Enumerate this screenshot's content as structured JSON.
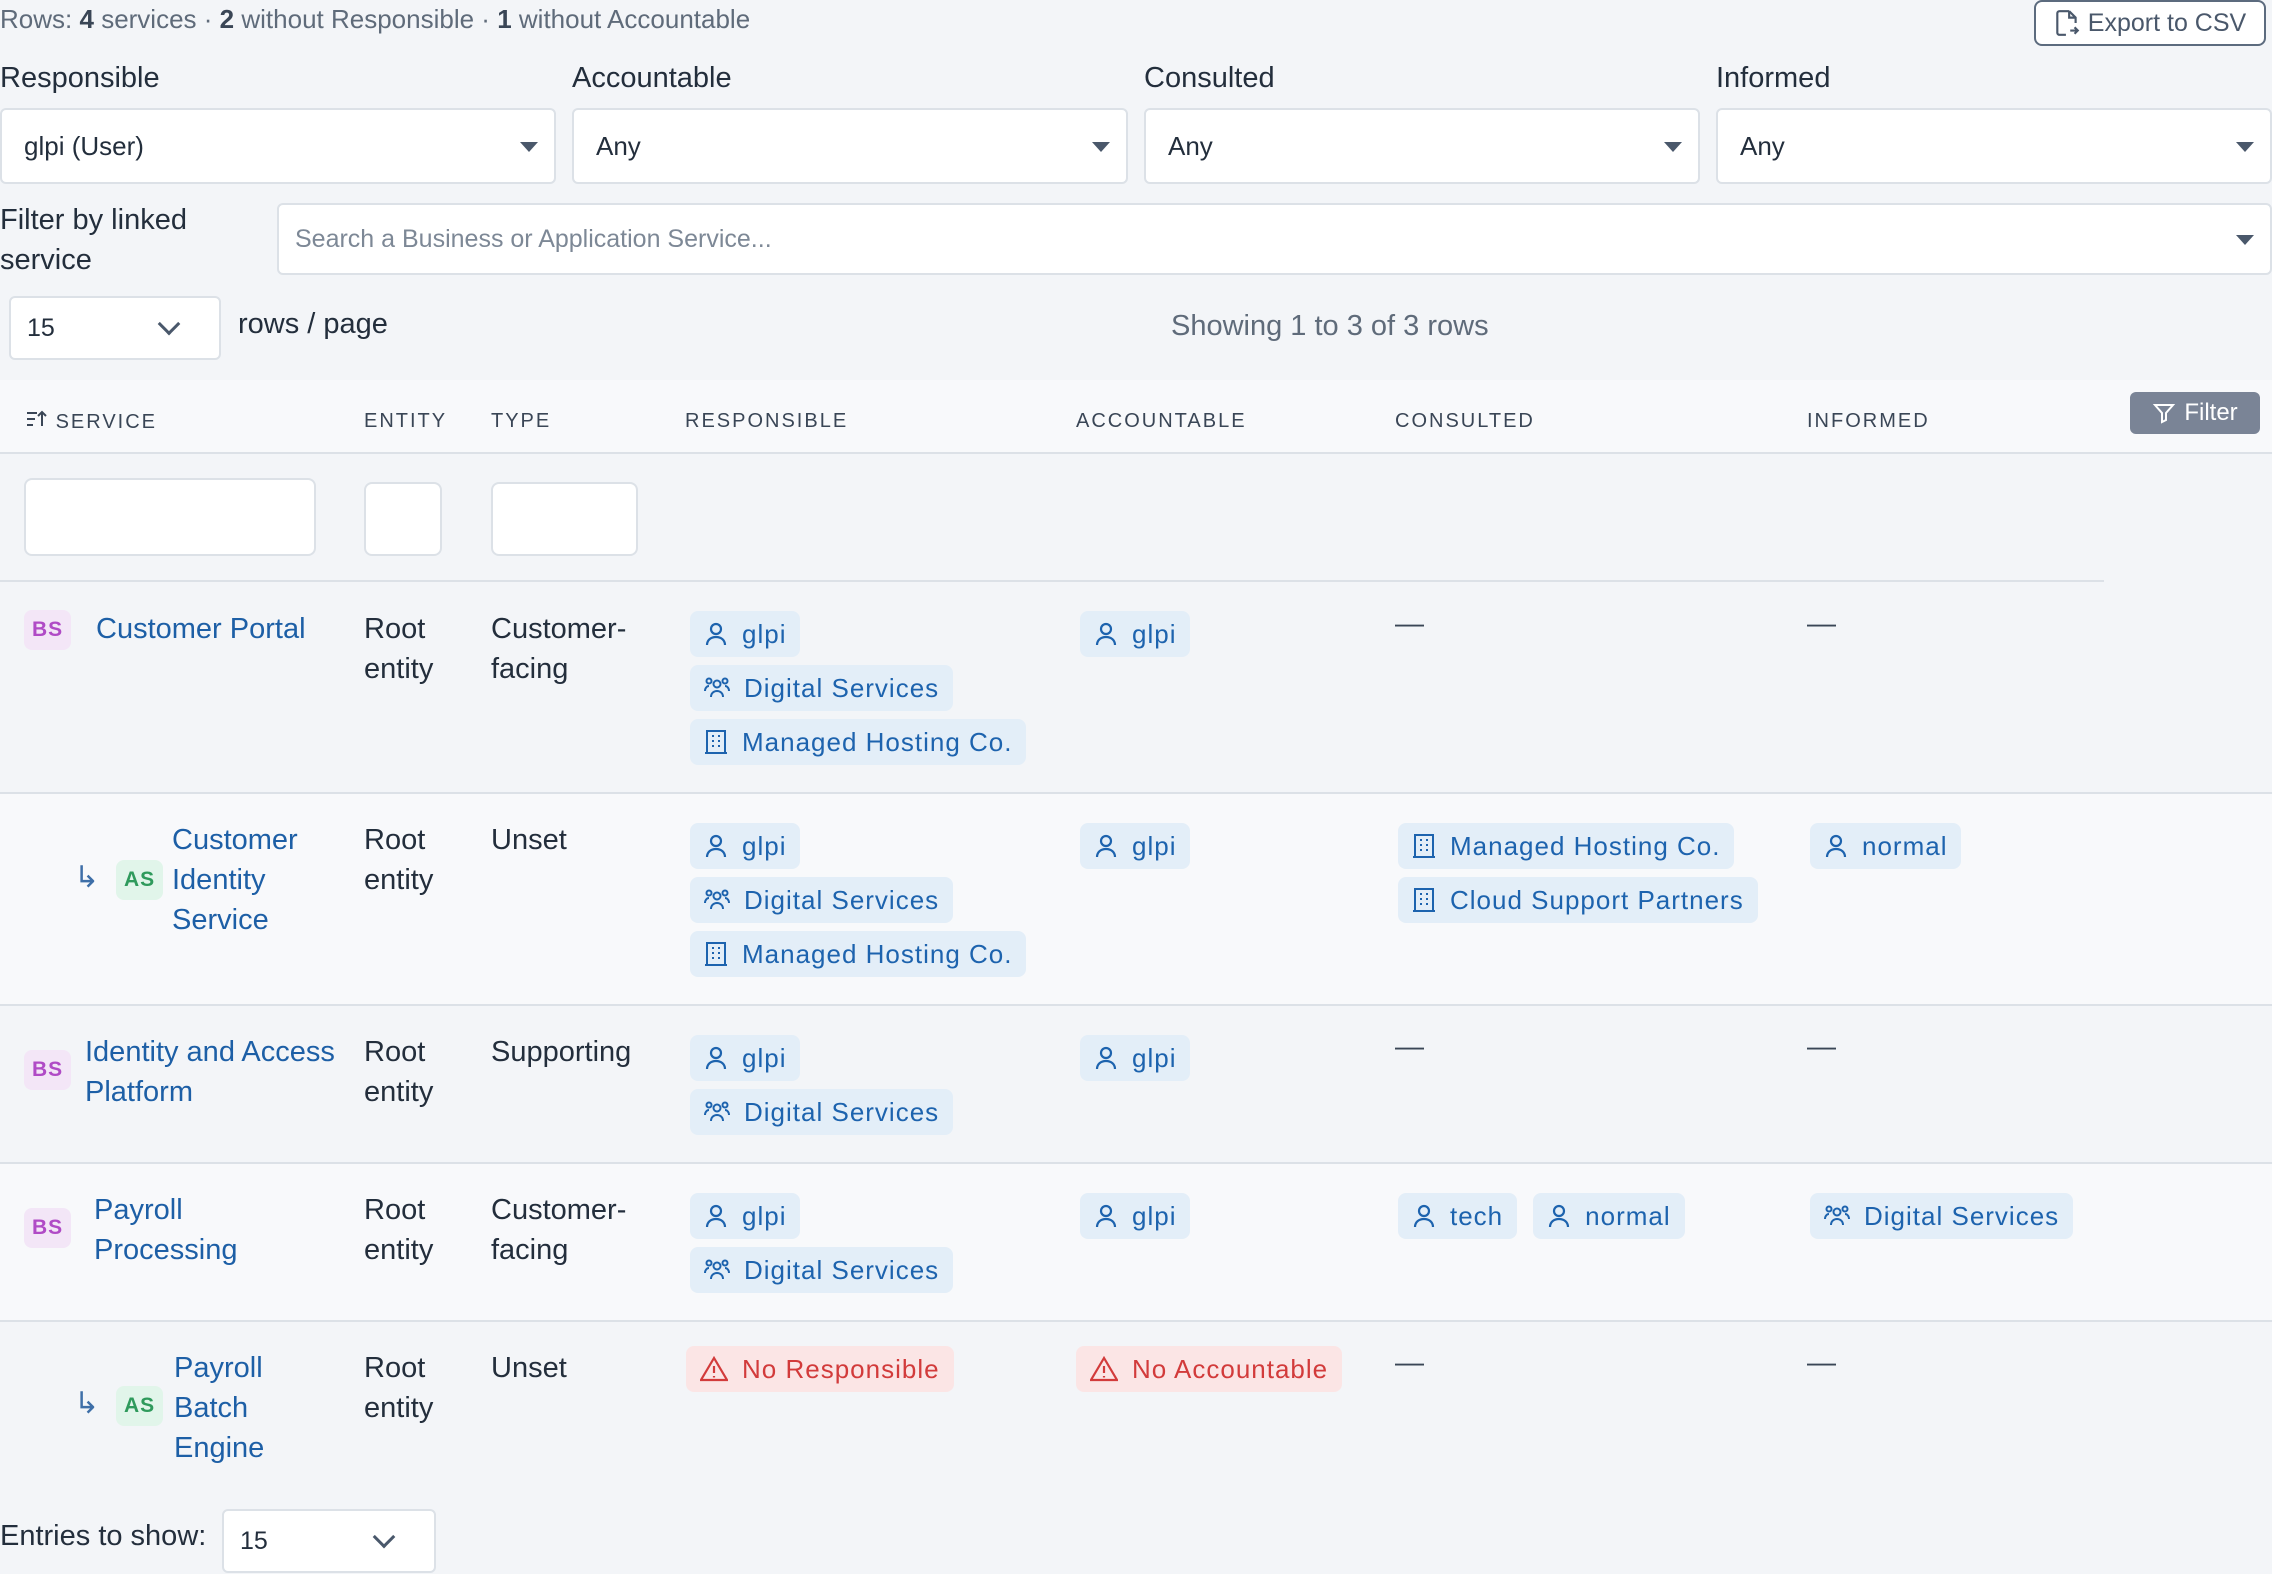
{
  "summary": {
    "prefix": "Rows:",
    "services_count": "4",
    "services_label": "services ·",
    "no_responsible_count": "2",
    "no_responsible_label": "without Responsible ·",
    "no_accountable_count": "1",
    "no_accountable_label": "without Accountable"
  },
  "toolbar": {
    "export_label": "Export to CSV"
  },
  "filters": {
    "responsible": {
      "label": "Responsible",
      "value": "glpi (User)"
    },
    "accountable": {
      "label": "Accountable",
      "value": "Any"
    },
    "consulted": {
      "label": "Consulted",
      "value": "Any"
    },
    "informed": {
      "label": "Informed",
      "value": "Any"
    },
    "linked_service": {
      "label": "Filter by linked service",
      "placeholder": "Search a Business or Application Service..."
    }
  },
  "pager": {
    "rows_per_page": "15",
    "rows_label": "rows / page",
    "showing": "Showing 1 to 3 of 3 rows"
  },
  "table": {
    "headers": {
      "service": "SERVICE",
      "entity": "ENTITY",
      "type": "TYPE",
      "responsible": "RESPONSIBLE",
      "accountable": "ACCOUNTABLE",
      "consulted": "CONSULTED",
      "informed": "INFORMED"
    },
    "filter_button": "Filter",
    "dash": "—",
    "rows": [
      {
        "badge": "BS",
        "service": "Customer Portal",
        "entity": "Root entity",
        "type": "Customer-facing",
        "responsible": [
          {
            "icon": "user-icon",
            "label": "glpi"
          },
          {
            "icon": "group-icon",
            "label": "Digital Services"
          },
          {
            "icon": "building-icon",
            "label": "Managed Hosting Co."
          }
        ],
        "accountable": [
          {
            "icon": "user-icon",
            "label": "glpi"
          }
        ]
      },
      {
        "badge": "AS",
        "service": "Customer Identity Service",
        "entity": "Root entity",
        "type": "Unset",
        "responsible": [
          {
            "icon": "user-icon",
            "label": "glpi"
          },
          {
            "icon": "group-icon",
            "label": "Digital Services"
          },
          {
            "icon": "building-icon",
            "label": "Managed Hosting Co."
          }
        ],
        "accountable": [
          {
            "icon": "user-icon",
            "label": "glpi"
          }
        ],
        "consulted": [
          {
            "icon": "building-icon",
            "label": "Managed Hosting Co."
          },
          {
            "icon": "building-icon",
            "label": "Cloud Support Partners"
          }
        ],
        "informed": [
          {
            "icon": "user-icon",
            "label": "normal"
          }
        ]
      },
      {
        "badge": "BS",
        "service": "Identity and Access Platform",
        "entity": "Root entity",
        "type": "Supporting",
        "responsible": [
          {
            "icon": "user-icon",
            "label": "glpi"
          },
          {
            "icon": "group-icon",
            "label": "Digital Services"
          }
        ],
        "accountable": [
          {
            "icon": "user-icon",
            "label": "glpi"
          }
        ]
      },
      {
        "badge": "BS",
        "service": "Payroll Processing",
        "entity": "Root entity",
        "type": "Customer-facing",
        "responsible": [
          {
            "icon": "user-icon",
            "label": "glpi"
          },
          {
            "icon": "group-icon",
            "label": "Digital Services"
          }
        ],
        "accountable": [
          {
            "icon": "user-icon",
            "label": "glpi"
          }
        ],
        "consulted": [
          {
            "icon": "user-icon",
            "label": "tech"
          },
          {
            "icon": "user-icon",
            "label": "normal"
          }
        ],
        "informed": [
          {
            "icon": "group-icon",
            "label": "Digital Services"
          }
        ]
      },
      {
        "badge": "AS",
        "service": "Payroll Batch Engine",
        "entity": "Root entity",
        "type": "Unset",
        "responsible_warning": "No Responsible",
        "accountable_warning": "No Accountable"
      }
    ]
  },
  "footer": {
    "entries_label": "Entries to show:",
    "entries_value": "15"
  },
  "colors": {
    "accent": "#1d63ae",
    "tag_bg": "#e3eef8",
    "warn": "#d23b3b",
    "warn_bg": "#fbe5e5"
  }
}
